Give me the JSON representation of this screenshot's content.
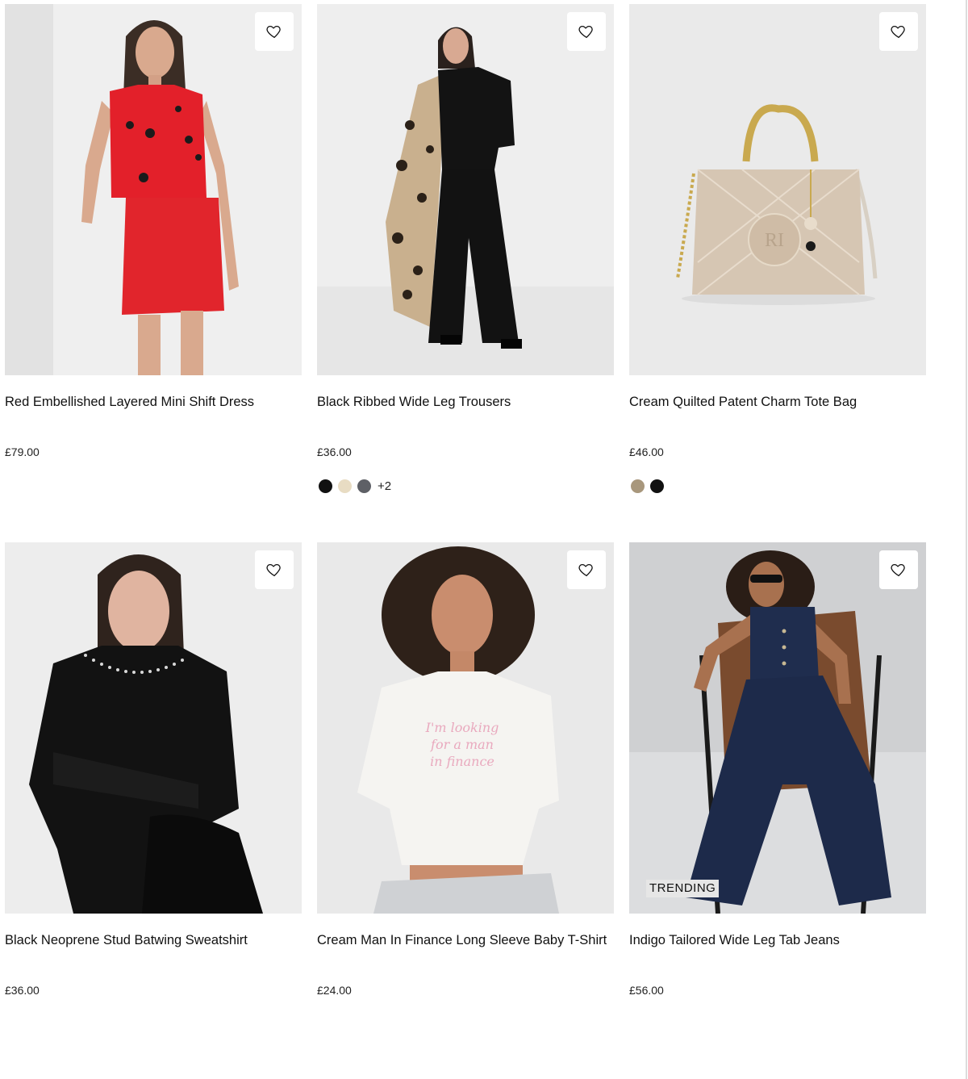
{
  "products": [
    {
      "title": "Red Embellished Layered Mini Shift Dress",
      "price": "£79.00",
      "image_bg": "#efefef",
      "swatches": []
    },
    {
      "title": "Black Ribbed Wide Leg Trousers",
      "price": "£36.00",
      "image_bg": "#eeeeee",
      "swatches": [
        "#111111",
        "#e8dcc3",
        "#5e6066"
      ],
      "more_colors": "+2"
    },
    {
      "title": "Cream Quilted Patent Charm Tote Bag",
      "price": "£46.00",
      "image_bg": "#eaeaea",
      "swatches": [
        "#a8977c",
        "#111111"
      ]
    },
    {
      "title": "Black Neoprene Stud Batwing Sweatshirt",
      "price": "£36.00",
      "image_bg": "#ededed",
      "swatches": []
    },
    {
      "title": "Cream Man In Finance Long Sleeve Baby T-Shirt",
      "price": "£24.00",
      "image_bg": "#e9e9e9",
      "swatches": []
    },
    {
      "title": "Indigo Tailored Wide Leg Tab Jeans",
      "price": "£56.00",
      "image_bg": "#cfd0d2",
      "badge": "TRENDING",
      "swatches": []
    }
  ],
  "icons": {
    "wishlist": "heart-outline-icon"
  }
}
